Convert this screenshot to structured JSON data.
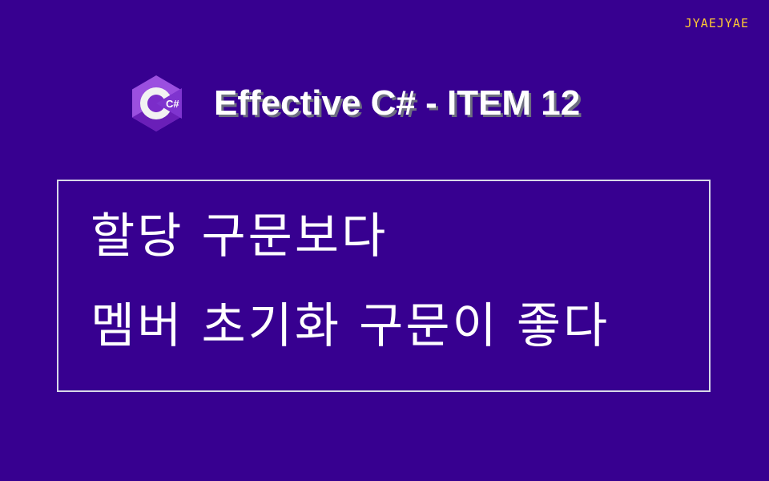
{
  "author": "JYAEJYAE",
  "logo": {
    "icon": "csharp-logo-icon",
    "text": "C#",
    "colors": {
      "outer_light": "#9b4fe0",
      "outer_dark": "#6a1fb8",
      "ring": "#f2f2f2",
      "inner": "#7b2cc9"
    }
  },
  "title": "Effective C# - ITEM 12",
  "body": {
    "line1": "할당 구문보다",
    "line2": "멤버 초기화 구문이 좋다"
  },
  "colors": {
    "background": "#370090",
    "author": "#ffc933",
    "text": "#ffffff",
    "border": "#d8d8e8"
  }
}
